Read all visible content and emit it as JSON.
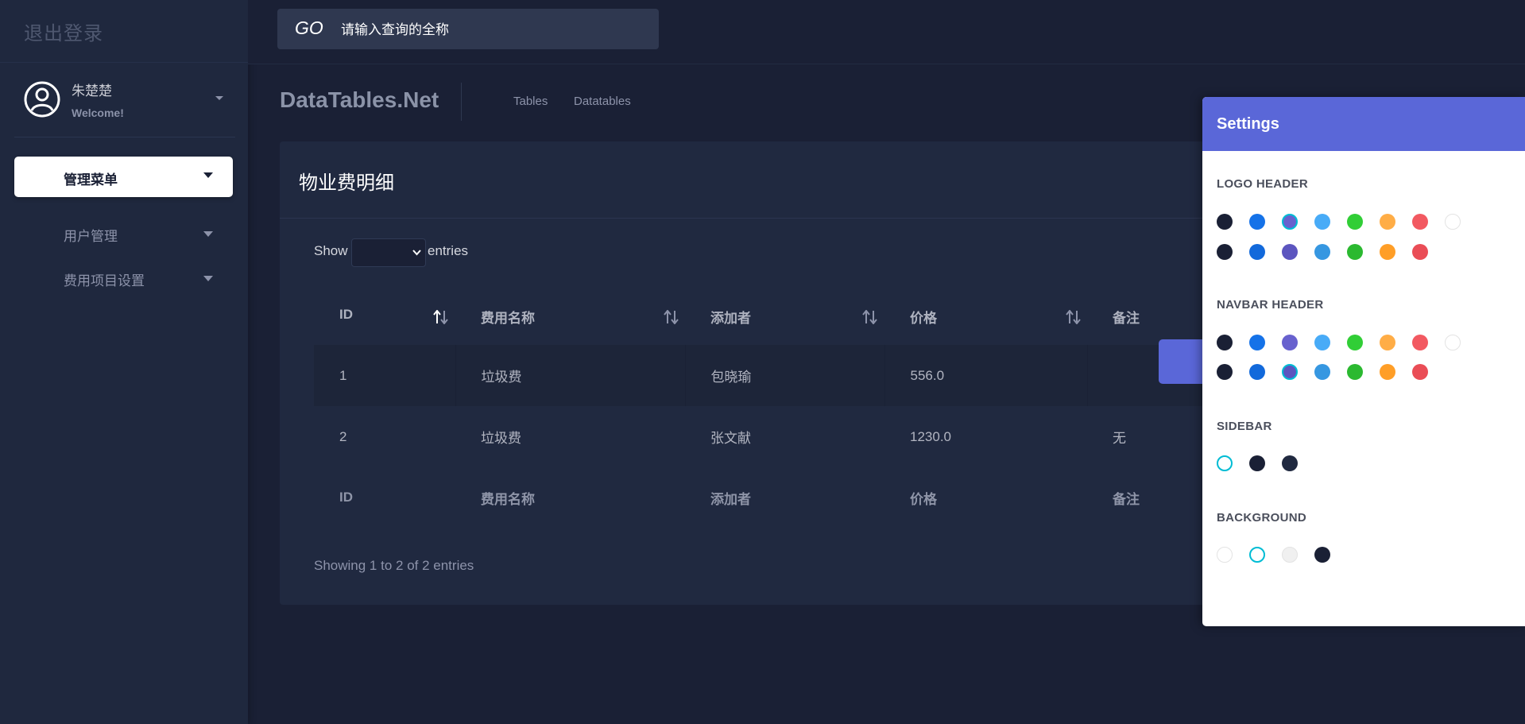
{
  "sidebar": {
    "logout_label": "退出登录",
    "user": {
      "name": "朱楚楚",
      "welcome": "Welcome!"
    },
    "menu_button": "管理菜单",
    "items": [
      {
        "label": "用户管理"
      },
      {
        "label": "费用项目设置"
      }
    ]
  },
  "topnav": {
    "go_label": "GO",
    "search_placeholder": "请输入查询的全称"
  },
  "page": {
    "title": "DataTables.Net",
    "breadcrumbs": [
      "Tables",
      "Datatables"
    ]
  },
  "card": {
    "title": "物业费明细",
    "show_label": "Show",
    "entries_label": "entries",
    "columns": [
      "ID",
      "费用名称",
      "添加者",
      "价格",
      "备注"
    ],
    "rows": [
      [
        "1",
        "垃圾费",
        "包晓瑜",
        "556.0",
        ""
      ],
      [
        "2",
        "垃圾费",
        "张文献",
        "1230.0",
        "无"
      ]
    ],
    "info": "Showing 1 to 2 of 2 entries"
  },
  "settings": {
    "title": "Settings",
    "logo_header": {
      "label": "LOGO HEADER",
      "row1": [
        "#1a2035",
        "#1572e8",
        "#6861ce",
        "#48abf7",
        "#31ce36",
        "#ffad46",
        "#f25961",
        "#ffffff"
      ],
      "row2": [
        "#1a2035",
        "#1269db",
        "#5c55bf",
        "#3697e1",
        "#2bb930",
        "#ff9e27",
        "#ea4d56"
      ],
      "selected": "row1.2"
    },
    "navbar_header": {
      "label": "NAVBAR HEADER",
      "row1": [
        "#1a2035",
        "#1572e8",
        "#6861ce",
        "#48abf7",
        "#31ce36",
        "#ffad46",
        "#f25961",
        "#ffffff"
      ],
      "row2": [
        "#1a2035",
        "#1269db",
        "#5c55bf",
        "#3697e1",
        "#2bb930",
        "#ff9e27",
        "#ea4d56"
      ],
      "selected": "row2.2"
    },
    "sidebar": {
      "label": "SIDEBAR",
      "colors": [
        "#ffffff",
        "#1a2035",
        "#202940"
      ],
      "selected": 0
    },
    "background": {
      "label": "BACKGROUND",
      "colors": [
        "#ffffff",
        "#ffffff",
        "#f0f0f0",
        "#1a2035"
      ],
      "selected": 1
    },
    "selected_ring": "#00bcd4"
  },
  "colors": {
    "accent": "#5a67d8",
    "sidebar_bg": "#1f283e",
    "body_bg": "#1a2035",
    "card_bg": "#202940"
  }
}
